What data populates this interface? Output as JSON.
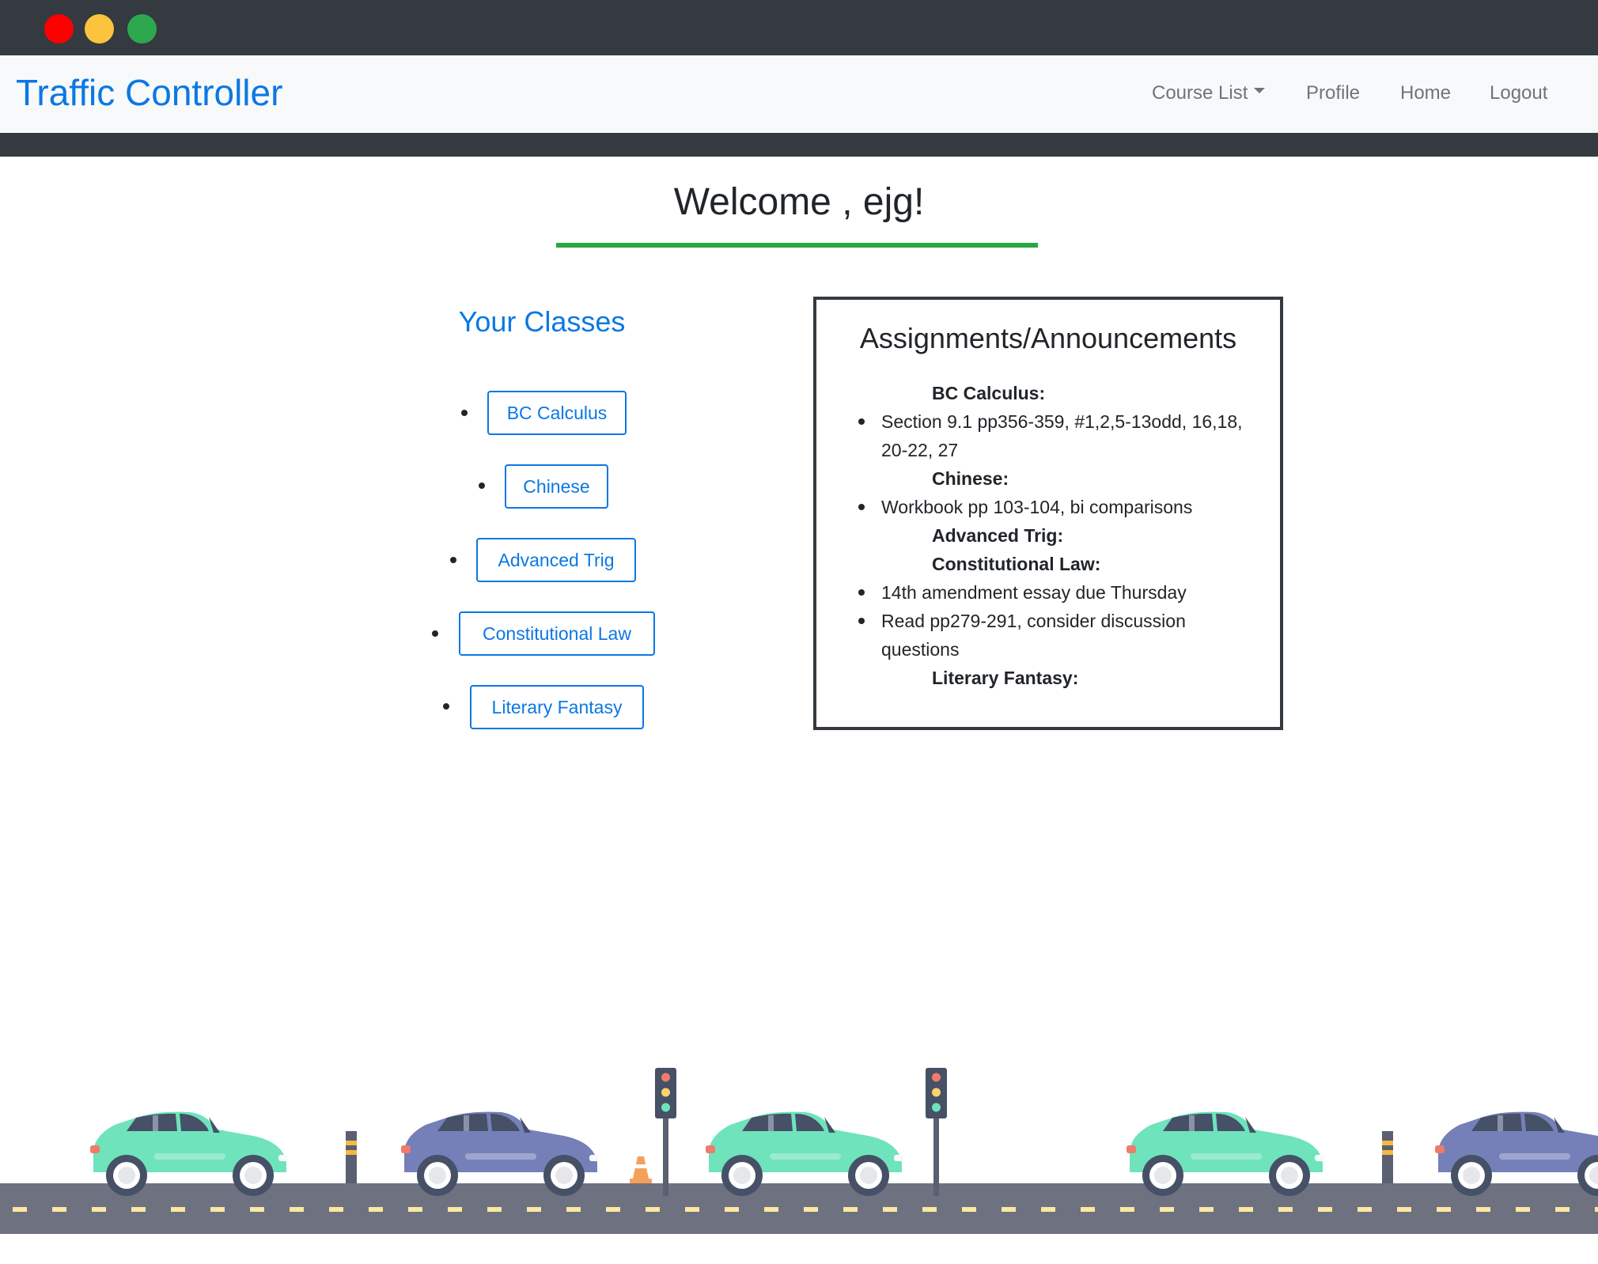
{
  "window": {
    "controls": [
      "close",
      "minimize",
      "maximize"
    ]
  },
  "navbar": {
    "brand": "Traffic Controller",
    "links": {
      "course_list": "Course List",
      "profile": "Profile",
      "home": "Home",
      "logout": "Logout"
    }
  },
  "welcome": {
    "text": "Welcome , ejg!"
  },
  "classes": {
    "title": "Your Classes",
    "items": [
      "BC Calculus",
      "Chinese",
      "Advanced Trig",
      "Constitutional Law",
      "Literary Fantasy"
    ]
  },
  "assignments": {
    "title": "Assignments/Announcements",
    "courses": [
      {
        "name": "BC Calculus:",
        "items": [
          "Section 9.1 pp356-359, #1,2,5-13odd, 16,18, 20-22, 27"
        ]
      },
      {
        "name": "Chinese:",
        "items": [
          "Workbook pp 103-104, bi comparisons"
        ]
      },
      {
        "name": "Advanced Trig:",
        "items": []
      },
      {
        "name": "Constitutional Law:",
        "items": [
          "14th amendment essay due Thursday",
          "Read pp279-291, consider discussion questions"
        ]
      },
      {
        "name": "Literary Fantasy:",
        "items": []
      }
    ]
  },
  "colors": {
    "brand": "#0b78e3",
    "dark_bar": "#343a40",
    "accent_rule": "#28a745",
    "car_green": "#6fe3bc",
    "car_blue": "#7580b8",
    "road": "#6e717f"
  }
}
